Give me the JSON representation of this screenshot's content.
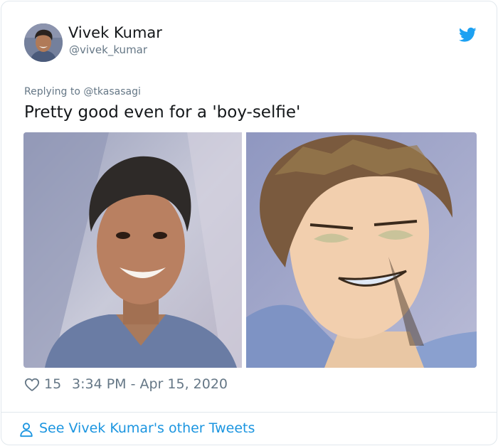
{
  "tweet": {
    "author": {
      "display_name": "Vivek Kumar",
      "handle": "@vivek_kumar",
      "avatar_icon": "avatar-photo"
    },
    "brand_icon": "twitter-bird-icon",
    "brand_color": "#1da1f2",
    "reply_prefix": "Replying to ",
    "reply_mention": "@tkasasagi",
    "text": "Pretty good even for a 'boy-selfie'",
    "media": [
      {
        "kind": "photo",
        "subject": "man-smiling-photo"
      },
      {
        "kind": "illustration",
        "subject": "anime-style-portrait"
      }
    ],
    "like_icon": "heart-outline-icon",
    "like_count": "15",
    "timestamp": "3:34 PM - Apr 15, 2020"
  },
  "footer": {
    "icon": "person-outline-icon",
    "link_text": "See Vivek Kumar's other Tweets",
    "link_color": "#1b95e0"
  },
  "colors": {
    "text_primary": "#14171a",
    "text_secondary": "#657786",
    "border": "#e1e8ed"
  }
}
